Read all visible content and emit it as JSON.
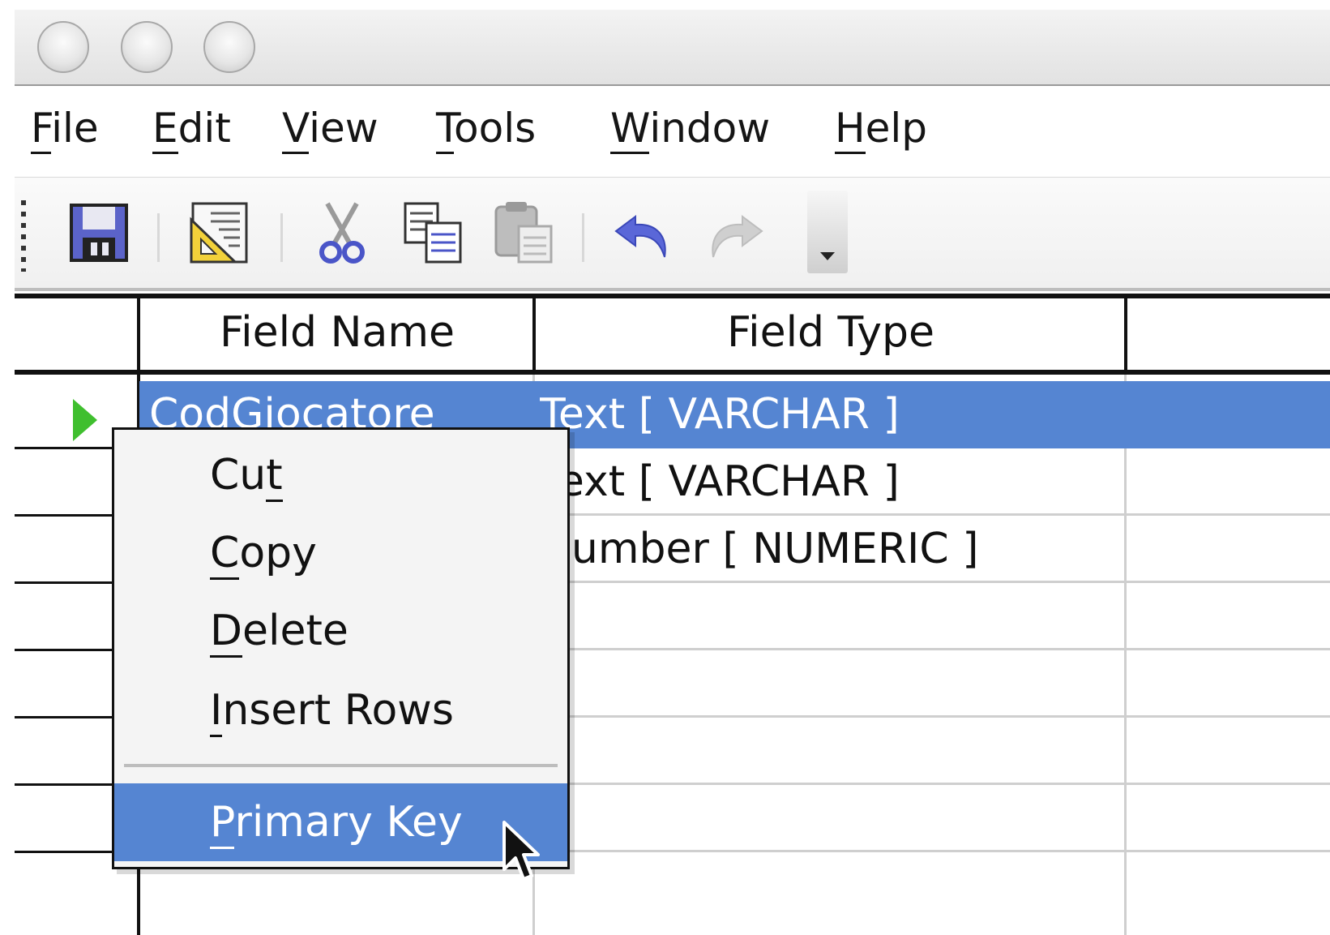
{
  "menubar": {
    "items": [
      {
        "mnemonic": "F",
        "rest": "ile"
      },
      {
        "mnemonic": "E",
        "rest": "dit"
      },
      {
        "mnemonic": "V",
        "rest": "iew"
      },
      {
        "mnemonic": "T",
        "rest": "ools"
      },
      {
        "mnemonic": "W",
        "rest": "indow"
      },
      {
        "mnemonic": "H",
        "rest": "elp"
      }
    ]
  },
  "toolbar": {
    "icons": [
      "save-icon",
      "edit-document-icon",
      "cut-icon",
      "copy-icon",
      "paste-icon",
      "undo-icon",
      "redo-icon",
      "dropdown-arrow-icon"
    ]
  },
  "table": {
    "headers": {
      "field_name": "Field Name",
      "field_type": "Field Type",
      "description": ""
    },
    "rows": [
      {
        "field_name": "CodGiocatore",
        "field_type": "Text [ VARCHAR ]",
        "selected": true
      },
      {
        "field_name": "",
        "field_type": "Text [ VARCHAR ]",
        "selected": false
      },
      {
        "field_name": "",
        "field_type": "Number [ NUMERIC ]",
        "selected": false
      },
      {
        "field_name": "",
        "field_type": "",
        "selected": false
      },
      {
        "field_name": "",
        "field_type": "",
        "selected": false
      },
      {
        "field_name": "",
        "field_type": "",
        "selected": false
      },
      {
        "field_name": "",
        "field_type": "",
        "selected": false
      }
    ]
  },
  "context_menu": {
    "items": [
      {
        "pre": "Cu",
        "mnemonic": "t",
        "post": ""
      },
      {
        "pre": "",
        "mnemonic": "C",
        "post": "opy"
      },
      {
        "pre": "",
        "mnemonic": "D",
        "post": "elete"
      },
      {
        "pre": "",
        "mnemonic": "I",
        "post": "nsert Rows"
      },
      {
        "pre": "",
        "mnemonic": "P",
        "post": "rimary Key"
      }
    ]
  },
  "colors": {
    "selection": "#5585d2",
    "row_pointer": "#3fbf2e"
  }
}
